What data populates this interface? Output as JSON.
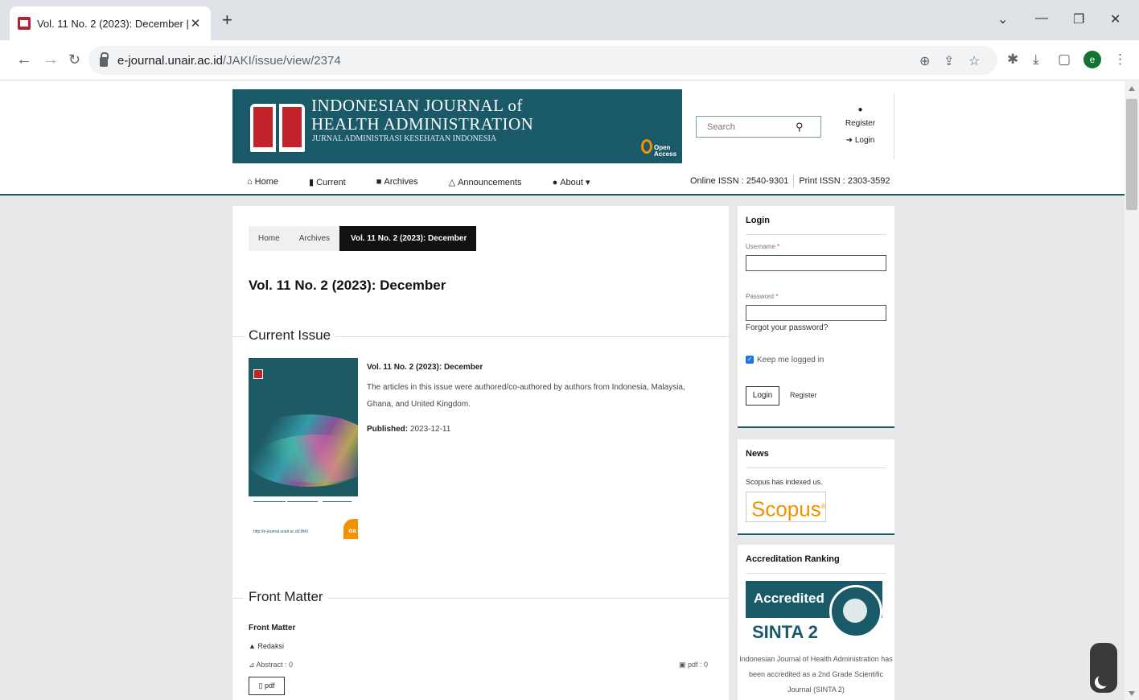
{
  "browser": {
    "tab_title": "Vol. 11 No. 2 (2023): December |",
    "tab_close": "✕",
    "new_tab": "+",
    "url_host": "e-journal.unair.ac.id",
    "url_path": "/JAKI/issue/view/2374",
    "profile_initial": "e",
    "window_controls": [
      "⌄",
      "—",
      "❐",
      "✕"
    ]
  },
  "header": {
    "logo_line1": "INDONESIAN JOURNAL of",
    "logo_line2": "HEALTH ADMINISTRATION",
    "logo_line3": "JURNAL ADMINISTRASI KESEHATAN INDONESIA",
    "open_access": "Open Access",
    "search_placeholder": "Search",
    "register": "Register",
    "login": "Login"
  },
  "nav": {
    "items": [
      {
        "icon": "home-icon",
        "label": "Home"
      },
      {
        "icon": "book-icon",
        "label": "Current"
      },
      {
        "icon": "archive-icon",
        "label": "Archives"
      },
      {
        "icon": "bell-icon",
        "label": "Announcements"
      },
      {
        "icon": "info-icon",
        "label": "About"
      }
    ],
    "about_caret": "▾",
    "online_issn": "Online ISSN : 2540-9301",
    "print_issn": "Print ISSN : 2303-3592"
  },
  "breadcrumb": [
    "Home",
    "Archives",
    "Vol. 11 No. 2 (2023): December"
  ],
  "page_title": "Vol. 11 No. 2 (2023): December",
  "current_issue": {
    "heading": "Current Issue",
    "title": "Vol. 11 No. 2 (2023): December",
    "description": "The articles in this issue were authored/co-authored by authors from Indonesia, Malaysia, Ghana, and United Kingdom.",
    "published_label": "Published:",
    "published_date": "2023-12-11",
    "cover_url": "http://e-journal.unair.ac.id/JAKI",
    "cover_oa": "oa"
  },
  "front_matter": {
    "heading": "Front Matter",
    "category": "Front Matter",
    "item": "Redaksi",
    "abstract": "Abstract : 0",
    "pdf_count": "pdf : 0",
    "pdf_button": "pdf"
  },
  "sidebar": {
    "login": {
      "title": "Login",
      "username_label": "Username",
      "password_label": "Password",
      "required": "*",
      "forgot": "Forgot your password?",
      "keep": "Keep me logged in",
      "button": "Login",
      "register": "Register"
    },
    "news": {
      "title": "News",
      "text": "Scopus has indexed us.",
      "scopus": "Scopus"
    },
    "accreditation": {
      "title": "Accreditation Ranking",
      "accredited": "Accredited",
      "sinta": "SINTA 2",
      "description": "Indonesian Journal of Health Administration has been accredited as a 2nd Grade Scientific Journal (SINTA 2)"
    }
  },
  "colors": {
    "brand_teal": "#1a5a68",
    "brand_red": "#c3242c",
    "oa_orange": "#f39200"
  }
}
